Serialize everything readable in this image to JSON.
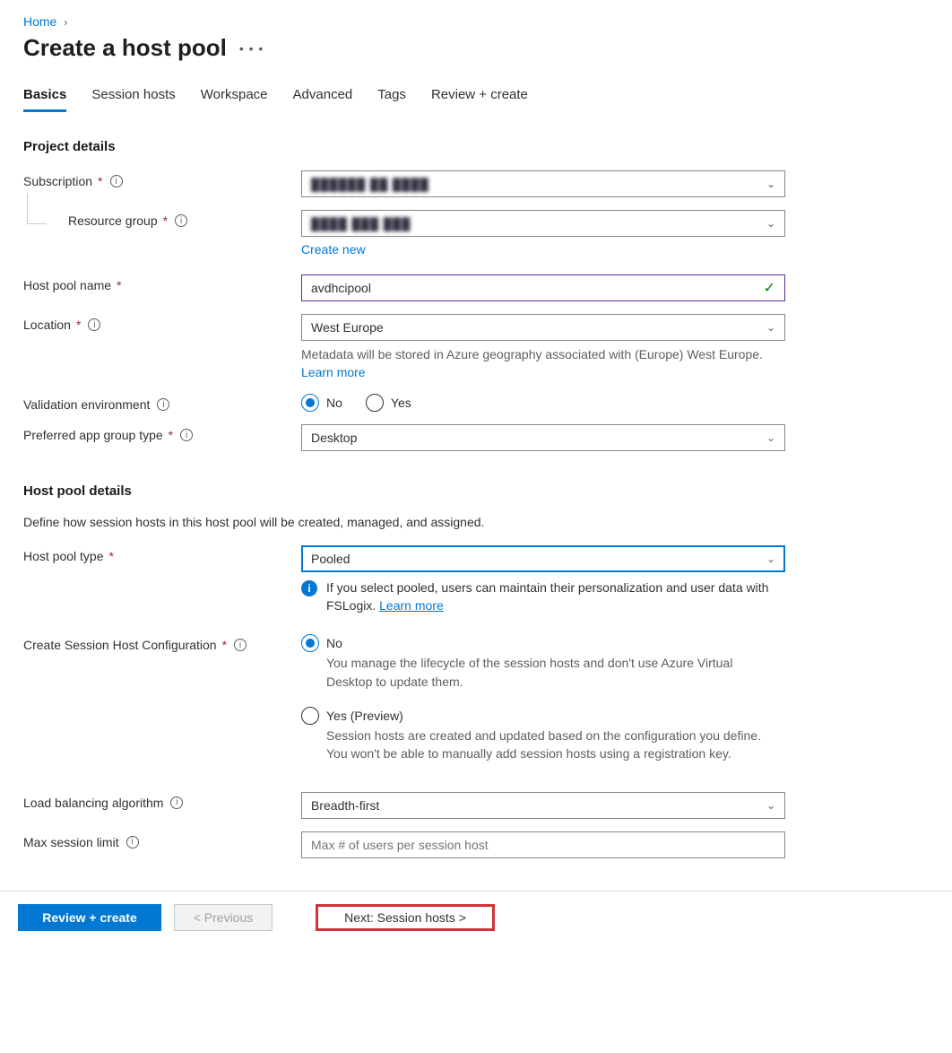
{
  "breadcrumb": {
    "home": "Home"
  },
  "page": {
    "title": "Create a host pool"
  },
  "tabs": [
    "Basics",
    "Session hosts",
    "Workspace",
    "Advanced",
    "Tags",
    "Review + create"
  ],
  "project": {
    "heading": "Project details",
    "subscription_label": "Subscription",
    "subscription_value": "██████  ██  ████",
    "rg_label": "Resource group",
    "rg_value": "████  ███  ███",
    "create_new": "Create new",
    "hostpool_name_label": "Host pool name",
    "hostpool_name_value": "avdhcipool",
    "location_label": "Location",
    "location_value": "West Europe",
    "location_helper_pre": "Metadata will be stored in Azure geography associated with (Europe) West Europe. ",
    "location_helper_link": "Learn more",
    "validation_label": "Validation environment",
    "validation_no": "No",
    "validation_yes": "Yes",
    "appgroup_label": "Preferred app group type",
    "appgroup_value": "Desktop"
  },
  "details": {
    "heading": "Host pool details",
    "description": "Define how session hosts in this host pool will be created, managed, and assigned.",
    "type_label": "Host pool type",
    "type_value": "Pooled",
    "type_info_pre": "If you select pooled, users can maintain their personalization and user data with FSLogix. ",
    "type_info_link": "Learn more",
    "shc_label": "Create Session Host Configuration",
    "shc_no_label": "No",
    "shc_no_desc": "You manage the lifecycle of the session hosts and don't use Azure Virtual Desktop to update them.",
    "shc_yes_label": "Yes (Preview)",
    "shc_yes_desc": "Session hosts are created and updated based on the configuration you define. You won't be able to manually add session hosts using a registration key.",
    "lb_label": "Load balancing algorithm",
    "lb_value": "Breadth-first",
    "max_label": "Max session limit",
    "max_placeholder": "Max # of users per session host"
  },
  "footer": {
    "review": "Review + create",
    "previous": "< Previous",
    "next": "Next: Session hosts >"
  }
}
